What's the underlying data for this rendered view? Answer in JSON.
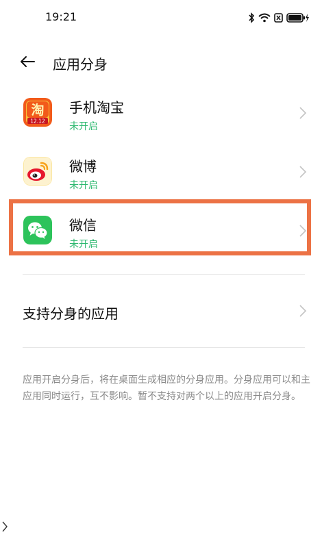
{
  "status_bar": {
    "time": "19:21",
    "icons": [
      "bluetooth-icon",
      "wifi-icon",
      "sim-off-icon",
      "battery-charging-icon"
    ]
  },
  "header": {
    "back_icon": "arrow-left-icon",
    "title": "应用分身"
  },
  "apps": [
    {
      "name": "手机淘宝",
      "status": "未开启",
      "icon": "taobao-icon",
      "icon_label": "12.12"
    },
    {
      "name": "微博",
      "status": "未开启",
      "icon": "weibo-icon"
    },
    {
      "name": "微信",
      "status": "未开启",
      "icon": "wechat-icon",
      "highlighted": true
    }
  ],
  "support_row": {
    "label": "支持分身的应用"
  },
  "description": "应用开启分身后，将在桌面生成相应的分身应用。分身应用可以和主应用同时运行，互不影响。暂不支持对两个以上的应用开启分身。",
  "colors": {
    "status_green": "#2bb86e",
    "highlight_orange": "#ec7245",
    "wechat_green": "#2dc35b",
    "taobao_orange": "#f25a1a",
    "weibo_yellow": "#f7b21a"
  }
}
